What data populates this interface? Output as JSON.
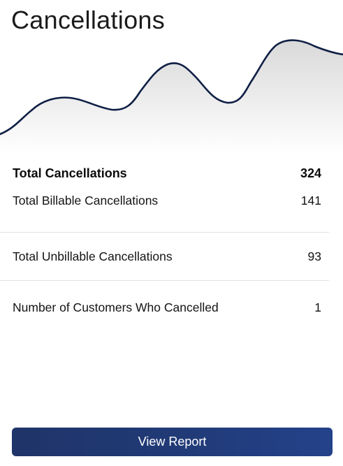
{
  "card": {
    "title": "Cancellations"
  },
  "sparkline": {
    "stroke_color": "#0f1f45",
    "fill_top": "#dcdcdc",
    "fill_bottom": "#ffffff"
  },
  "stats": {
    "total": {
      "label": "Total Cancellations",
      "value": "324"
    },
    "rows": [
      {
        "label": "Total Billable Cancellations",
        "value": "141"
      },
      {
        "label": "Total Unbillable  Cancellations",
        "value": "93"
      },
      {
        "label": "Number of Customers Who Cancelled",
        "value": "1"
      }
    ]
  },
  "actions": {
    "view_report_label": "View Report"
  },
  "colors": {
    "button_start": "#1f3468",
    "button_end": "#24428a"
  }
}
